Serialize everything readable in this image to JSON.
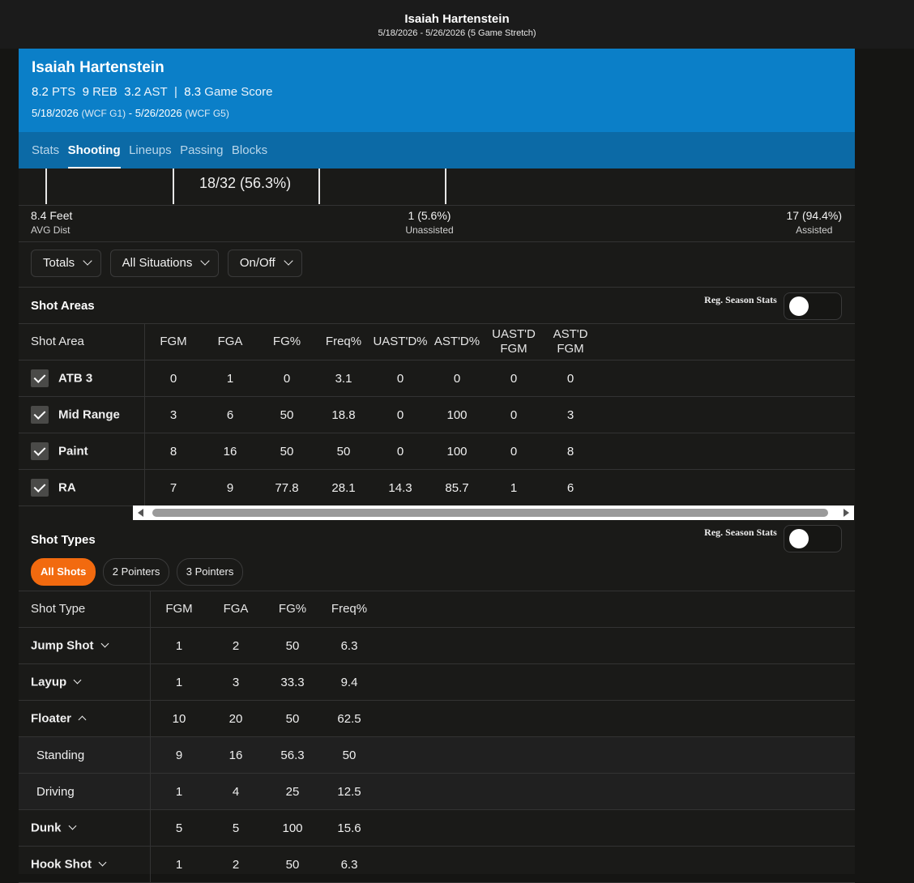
{
  "topbar": {
    "title": "Isaiah Hartenstein",
    "subtitle": "5/18/2026 - 5/26/2026 (5 Game Stretch)"
  },
  "hero": {
    "name": "Isaiah Hartenstein",
    "pts_val": "8.2",
    "pts_lbl": "PTS",
    "reb_val": "9",
    "reb_lbl": "REB",
    "ast_val": "3.2",
    "ast_lbl": "AST",
    "sep": "|",
    "gs_val": "8.3",
    "gs_lbl": "Game Score",
    "range_start": "5/18/2026",
    "range_start_note": "(WCF G1)",
    "range_dash": "-",
    "range_end": "5/26/2026",
    "range_end_note": "(WCF G5)"
  },
  "tabs": [
    "Stats",
    "Shooting",
    "Lineups",
    "Passing",
    "Blocks"
  ],
  "active_tab": "Shooting",
  "court": {
    "fg_line": "18/32 (56.3%)"
  },
  "summary": {
    "avg_dist_val": "8.4 Feet",
    "avg_dist_lbl": "AVG Dist",
    "unassisted_val": "1 (5.6%)",
    "unassisted_lbl": "Unassisted",
    "assisted_val": "17 (94.4%)",
    "assisted_lbl": "Assisted"
  },
  "filters": {
    "totals": "Totals",
    "situations": "All Situations",
    "onoff": "On/Off"
  },
  "shot_areas": {
    "title": "Shot Areas",
    "reg_season_label": "Reg. Season Stats",
    "reg_season_on": false,
    "headers": [
      "Shot Area",
      "FGM",
      "FGA",
      "FG%",
      "Freq%",
      "UAST'D%",
      "AST'D%",
      "UAST'D FGM",
      "AST'D FGM"
    ],
    "rows": [
      {
        "area": "ATB 3",
        "checked": true,
        "fgm": "0",
        "fga": "1",
        "fg_pct": "0",
        "freq": "3.1",
        "uast_pct": "0",
        "ast_pct": "0",
        "uast_fgm": "0",
        "ast_fgm": "0"
      },
      {
        "area": "Mid Range",
        "checked": true,
        "fgm": "3",
        "fga": "6",
        "fg_pct": "50",
        "freq": "18.8",
        "uast_pct": "0",
        "ast_pct": "100",
        "uast_fgm": "0",
        "ast_fgm": "3"
      },
      {
        "area": "Paint",
        "checked": true,
        "fgm": "8",
        "fga": "16",
        "fg_pct": "50",
        "freq": "50",
        "uast_pct": "0",
        "ast_pct": "100",
        "uast_fgm": "0",
        "ast_fgm": "8"
      },
      {
        "area": "RA",
        "checked": true,
        "fgm": "7",
        "fga": "9",
        "fg_pct": "77.8",
        "freq": "28.1",
        "uast_pct": "14.3",
        "ast_pct": "85.7",
        "uast_fgm": "1",
        "ast_fgm": "6"
      }
    ]
  },
  "shot_types": {
    "title": "Shot Types",
    "reg_season_label": "Reg. Season Stats",
    "reg_season_on": false,
    "pills": [
      "All Shots",
      "2 Pointers",
      "3 Pointers"
    ],
    "active_pill": "All Shots",
    "headers": [
      "Shot Type",
      "FGM",
      "FGA",
      "FG%",
      "Freq%"
    ],
    "rows": [
      {
        "type": "Jump Shot",
        "expand": "down",
        "sub": false,
        "fgm": "1",
        "fga": "2",
        "fg_pct": "50",
        "freq": "6.3"
      },
      {
        "type": "Layup",
        "expand": "down",
        "sub": false,
        "fgm": "1",
        "fga": "3",
        "fg_pct": "33.3",
        "freq": "9.4"
      },
      {
        "type": "Floater",
        "expand": "up",
        "sub": false,
        "fgm": "10",
        "fga": "20",
        "fg_pct": "50",
        "freq": "62.5"
      },
      {
        "type": "Standing",
        "expand": "",
        "sub": true,
        "fgm": "9",
        "fga": "16",
        "fg_pct": "56.3",
        "freq": "50"
      },
      {
        "type": "Driving",
        "expand": "",
        "sub": true,
        "fgm": "1",
        "fga": "4",
        "fg_pct": "25",
        "freq": "12.5"
      },
      {
        "type": "Dunk",
        "expand": "down",
        "sub": false,
        "fgm": "5",
        "fga": "5",
        "fg_pct": "100",
        "freq": "15.6"
      },
      {
        "type": "Hook Shot",
        "expand": "down",
        "sub": false,
        "fgm": "1",
        "fga": "2",
        "fg_pct": "50",
        "freq": "6.3"
      }
    ]
  },
  "colors": {
    "hero": "#0b7fc8",
    "tabs": "#0c6aa6",
    "accent_pill": "#f26a0f",
    "background": "#151513"
  }
}
